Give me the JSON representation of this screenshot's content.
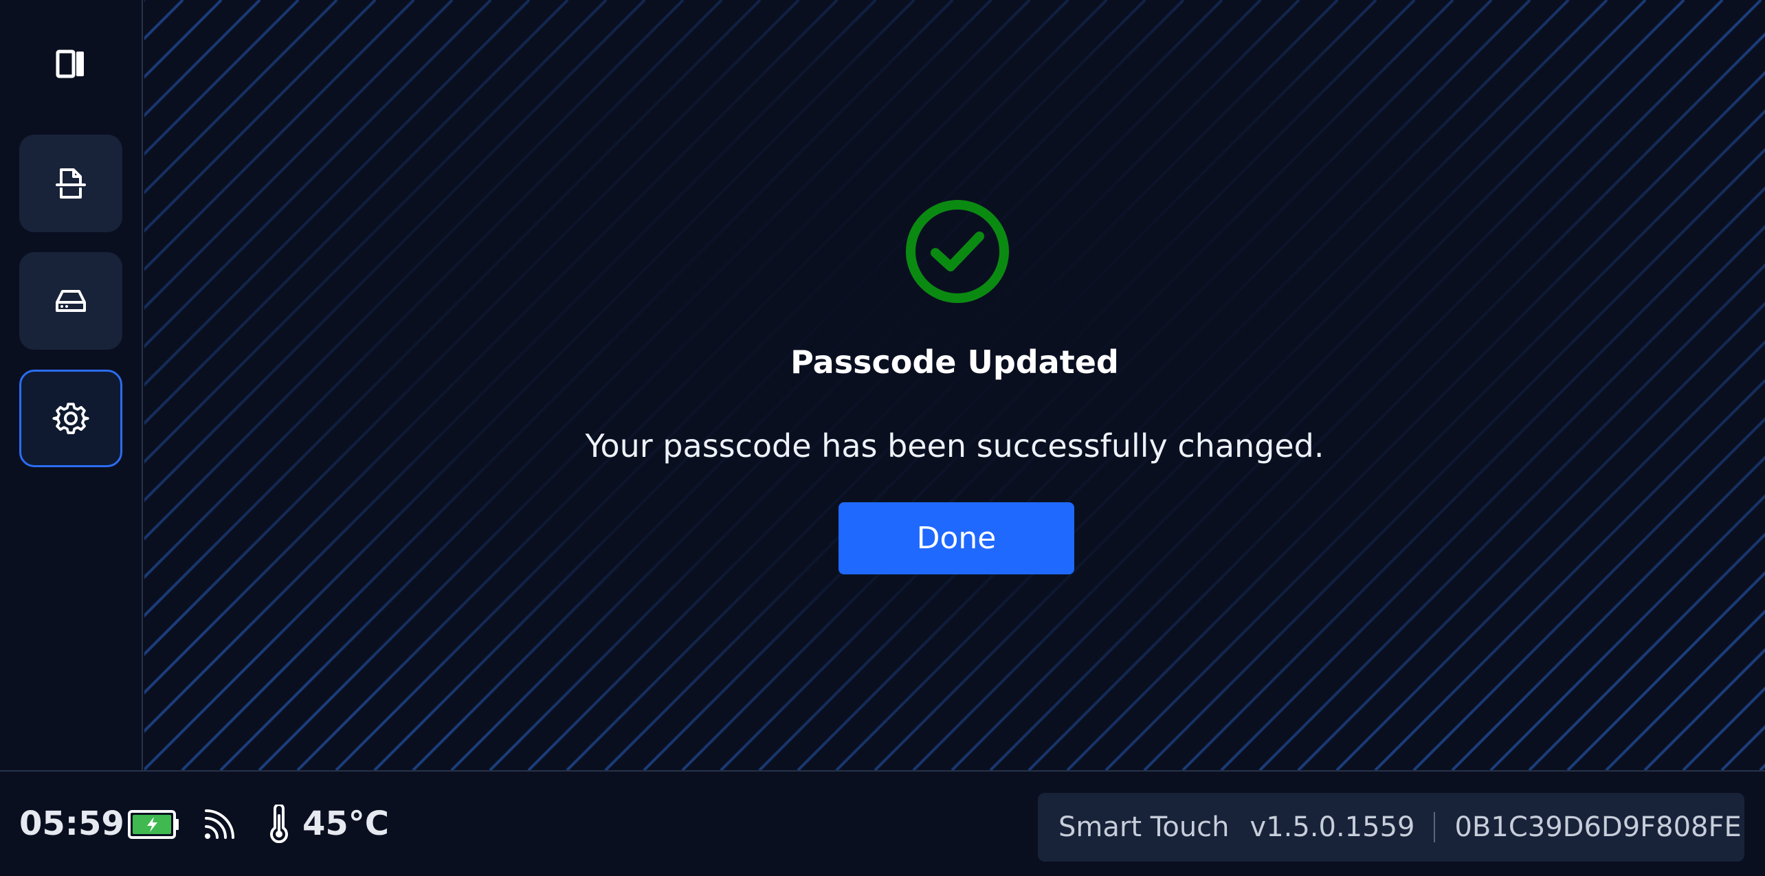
{
  "sidebar": {
    "toggle_icon": "panel-toggle-icon",
    "items": [
      {
        "name": "documents",
        "icon": "document-icon",
        "active": false
      },
      {
        "name": "storage",
        "icon": "drive-icon",
        "active": false
      },
      {
        "name": "settings",
        "icon": "gear-icon",
        "active": true
      }
    ]
  },
  "dialog": {
    "icon": "check-circle-icon",
    "title": "Passcode Updated",
    "message": "Your passcode has been successfully changed.",
    "done_label": "Done"
  },
  "status": {
    "time": "05:59",
    "battery_icon": "battery-charging-icon",
    "signal_icon": "wifi-signal-icon",
    "temperature_icon": "thermometer-icon",
    "temperature": "45°C",
    "app_name": "Smart Touch",
    "version": "v1.5.0.1559",
    "device_id": "0B1C39D6D9F808FE"
  },
  "colors": {
    "background": "#0a0f20",
    "panel": "#18233a",
    "accent": "#1f69ff",
    "success": "#0b8a12",
    "stripe": "#1b3d7a"
  }
}
